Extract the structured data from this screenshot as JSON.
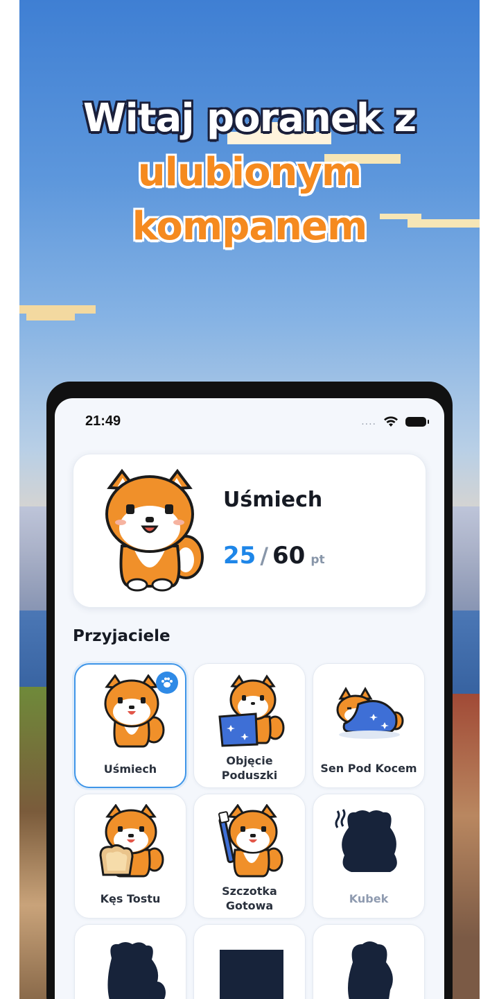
{
  "promo": {
    "line1": "Witaj poranek z",
    "line2": "ulubionym",
    "line3": "kompanem"
  },
  "status_bar": {
    "time": "21:49",
    "signal": "....",
    "icons": [
      "wifi-icon",
      "battery-icon"
    ]
  },
  "current_pet": {
    "name": "Uśmiech",
    "points_current": "25",
    "separator": "/",
    "points_total": "60",
    "unit": "pt"
  },
  "friends": {
    "title": "Przyjaciele",
    "items": [
      {
        "label": "Uśmiech",
        "unlocked": true,
        "selected": true
      },
      {
        "label": "Objęcie Poduszki",
        "unlocked": true,
        "selected": false
      },
      {
        "label": "Sen Pod Kocem",
        "unlocked": true,
        "selected": false
      },
      {
        "label": "Kęs Tostu",
        "unlocked": true,
        "selected": false
      },
      {
        "label": "Szczotka Gotowa",
        "unlocked": true,
        "selected": false
      },
      {
        "label": "Kubek",
        "unlocked": false,
        "selected": false
      }
    ]
  },
  "colors": {
    "accent": "#1e86e8",
    "headline_orange": "#f58a1f",
    "locked_silhouette": "#17233a"
  }
}
